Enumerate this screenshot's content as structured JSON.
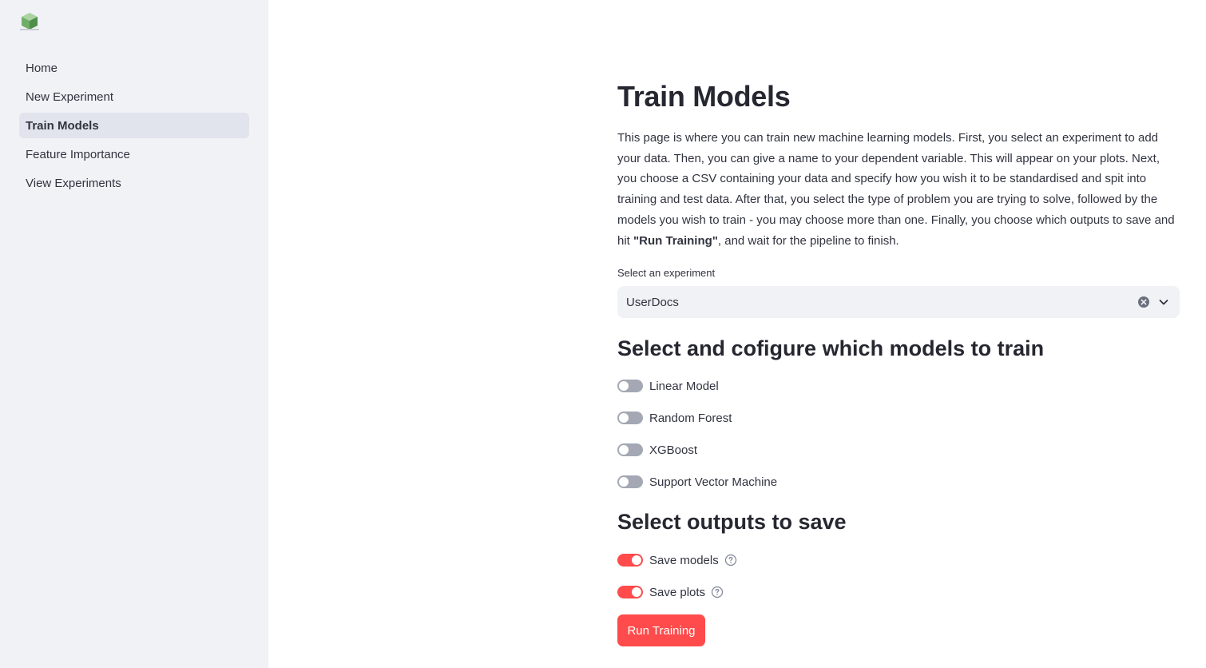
{
  "sidebar": {
    "logo_icon": "cube-logo-icon",
    "items": [
      {
        "label": "Home",
        "active": false
      },
      {
        "label": "New Experiment",
        "active": false
      },
      {
        "label": "Train Models",
        "active": true
      },
      {
        "label": "Feature Importance",
        "active": false
      },
      {
        "label": "View Experiments",
        "active": false
      }
    ]
  },
  "main": {
    "title": "Train Models",
    "intro_text": "This page is where you can train new machine learning models. First, you select an experiment to add your data. Then, you can give a name to your dependent variable. This will appear on your plots. Next, you choose a CSV containing your data and specify how you wish it to be standardised and spit into training and test data. After that, you select the type of problem you are trying to solve, followed by the models you wish to train - you may choose more than one. Finally, you choose which outputs to save and hit ",
    "intro_bold": "\"Run Training\"",
    "intro_end": ", and wait for the pipeline to finish.",
    "experiment_select": {
      "label": "Select an experiment",
      "value": "UserDocs",
      "clear_icon": "clear-circle-icon",
      "dropdown_icon": "chevron-down-icon"
    },
    "models_section": {
      "heading": "Select and cofigure which models to train",
      "models": [
        {
          "label": "Linear Model",
          "enabled": false
        },
        {
          "label": "Random Forest",
          "enabled": false
        },
        {
          "label": "XGBoost",
          "enabled": false
        },
        {
          "label": "Support Vector Machine",
          "enabled": false
        }
      ]
    },
    "outputs_section": {
      "heading": "Select outputs to save",
      "outputs": [
        {
          "label": "Save models",
          "enabled": true,
          "help_icon": "question-circle-icon"
        },
        {
          "label": "Save plots",
          "enabled": true,
          "help_icon": "question-circle-icon"
        }
      ]
    },
    "run_button_label": "Run Training"
  },
  "colors": {
    "accent": "#ff4b4b",
    "sidebar_bg": "#f0f2f6",
    "active_nav_bg": "#e1e4ec",
    "toggle_off": "#a3a8b4",
    "text": "#31333f"
  }
}
